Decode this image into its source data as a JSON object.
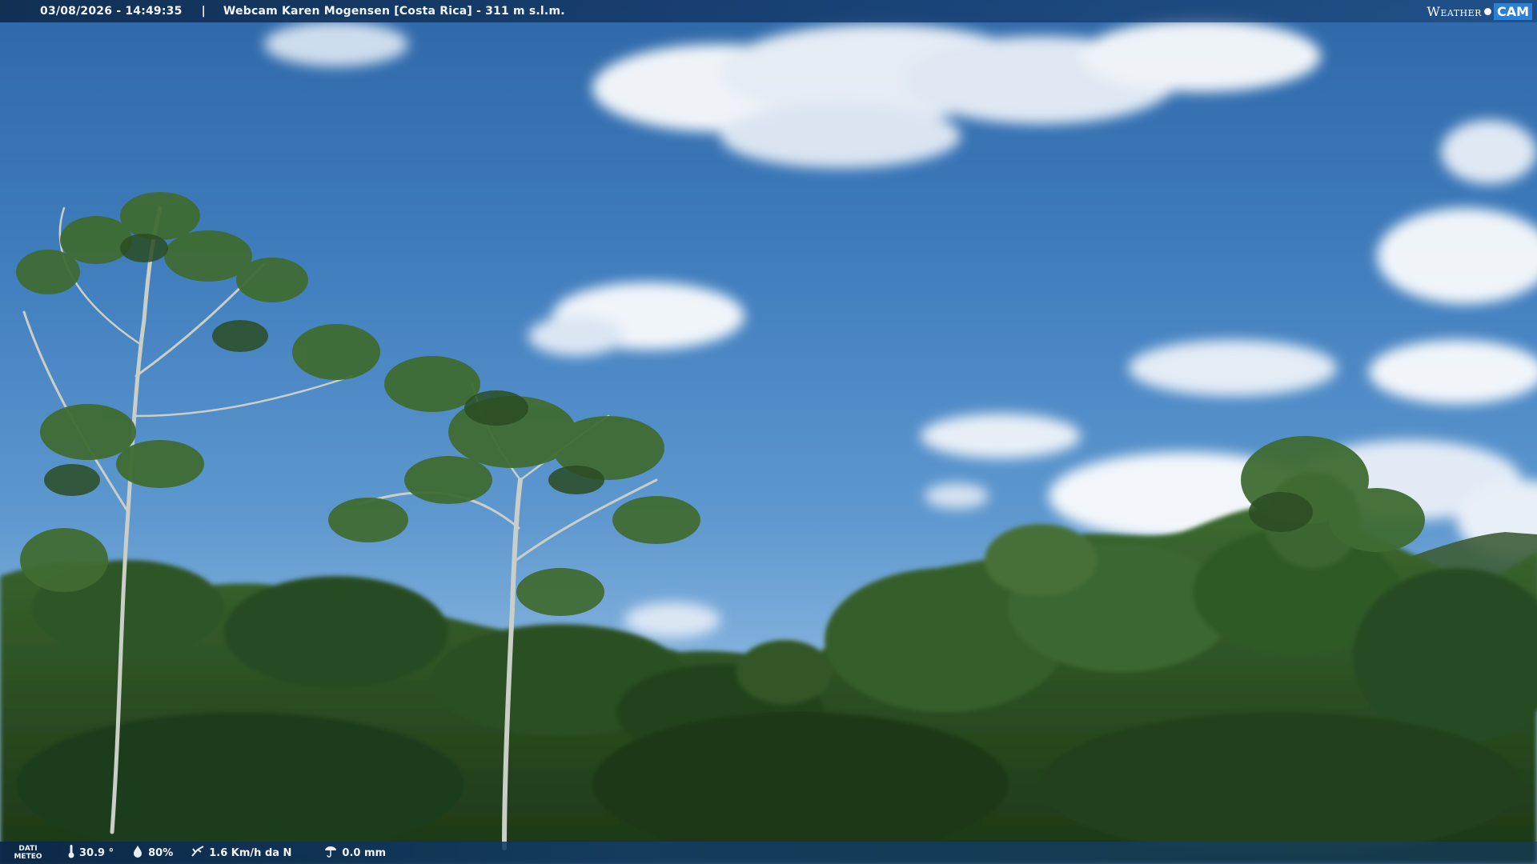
{
  "header": {
    "datetime": "03/08/2026 - 14:49:35",
    "separator": "|",
    "title": "Webcam Karen Mogensen [Costa Rica]  - 311 m s.l.m."
  },
  "logo": {
    "weather_text": "Weather",
    "cam_text": "CAM"
  },
  "meteo": {
    "label_line1": "DATI",
    "label_line2": "METEO",
    "temperature": "30.9 °",
    "humidity": "80%",
    "wind": "1.6 Km/h da N",
    "rain": "0.0 mm",
    "icons": {
      "temperature": "thermometer-icon",
      "humidity": "drop-icon",
      "wind": "wind-icon",
      "rain": "rain-gauge-icon"
    }
  },
  "colors": {
    "sky_top": "#2f68a8",
    "sky_bottom": "#a9c7e4",
    "foliage_dark": "#1f3d1a",
    "foliage_mid": "#2f5a26",
    "foliage_light": "#4c7a3a",
    "cloud": "#ffffff",
    "cam_badge": "#2d7fd3"
  }
}
